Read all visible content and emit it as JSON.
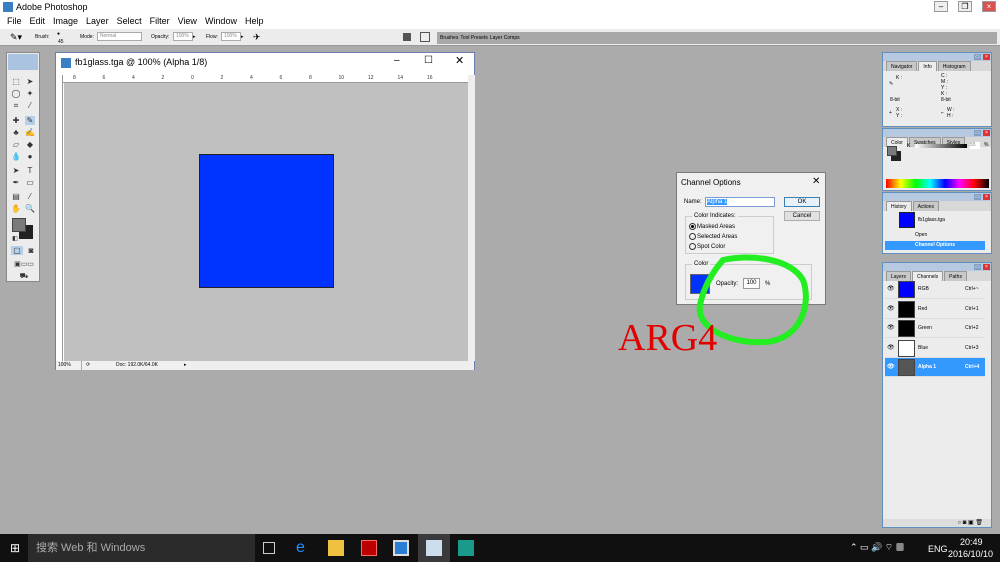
{
  "app": {
    "title": "Adobe Photoshop"
  },
  "menu": [
    "File",
    "Edit",
    "Image",
    "Layer",
    "Select",
    "Filter",
    "View",
    "Window",
    "Help"
  ],
  "options": {
    "brush_label": "Brush:",
    "brush_size": "45",
    "mode_label": "Mode:",
    "mode_value": "Normal",
    "opacity_label": "Opacity:",
    "opacity_value": "100%",
    "flow_label": "Flow:",
    "flow_value": "100%",
    "palette_tabs": [
      "Brushes",
      "Tool Presets",
      "Layer Comps"
    ]
  },
  "document": {
    "title": "fb1glass.tga @ 100% (Alpha 1/8)",
    "ruler_labels": [
      "8",
      "6",
      "4",
      "2",
      "0",
      "2",
      "4",
      "6",
      "8",
      "10",
      "12",
      "14",
      "16"
    ],
    "zoom": "100%",
    "doc_size": "Doc: 192.0K/64.0K",
    "colors": {
      "square": "#0033ff",
      "canvas": "#c0c0c0"
    }
  },
  "dialog": {
    "title": "Channel Options",
    "name_label": "Name:",
    "name_value": "Alpha 1",
    "ok": "OK",
    "cancel": "Cancel",
    "indicates_label": "Color Indicates:",
    "options": [
      "Masked Areas",
      "Selected Areas",
      "Spot Color"
    ],
    "selected": "Masked Areas",
    "color_label": "Color",
    "opacity_label": "Opacity:",
    "opacity_value": "100",
    "percent": "%",
    "swatch": "#0033ff"
  },
  "annotation": {
    "text": "ARG4",
    "color": "#e00000",
    "circle_color": "#22ee22"
  },
  "info_panel": {
    "tabs": [
      "Navigator",
      "Info",
      "Histogram"
    ],
    "k": "K :",
    "cmyk": [
      "C :",
      "M :",
      "Y :",
      "K :"
    ],
    "bit1": "8-bit",
    "bit2": "8-bit",
    "xy": [
      "X :",
      "Y :"
    ],
    "wh": [
      "W :",
      "H :"
    ]
  },
  "color_panel": {
    "tabs": [
      "Color",
      "Swatches",
      "Styles"
    ],
    "k_label": "K",
    "k_value": "55",
    "percent": "%"
  },
  "history_panel": {
    "tabs": [
      "History",
      "Actions"
    ],
    "snapshot": "fb1glass.tga",
    "items": [
      "Open",
      "Channel Options"
    ]
  },
  "channels_panel": {
    "tabs": [
      "Layers",
      "Channels",
      "Paths"
    ],
    "channels": [
      {
        "name": "RGB",
        "shortcut": "Ctrl+~",
        "thumb": "#0000ff"
      },
      {
        "name": "Red",
        "shortcut": "Ctrl+1",
        "thumb": "#000000"
      },
      {
        "name": "Green",
        "shortcut": "Ctrl+2",
        "thumb": "#000000"
      },
      {
        "name": "Blue",
        "shortcut": "Ctrl+3",
        "thumb": "#ffffff"
      },
      {
        "name": "Alpha 1",
        "shortcut": "Ctrl+4",
        "thumb": "#555555",
        "selected": true
      }
    ]
  },
  "taskbar": {
    "search": "搜索 Web 和 Windows",
    "lang": "ENG",
    "time": "20:49",
    "date": "2016/10/10"
  }
}
